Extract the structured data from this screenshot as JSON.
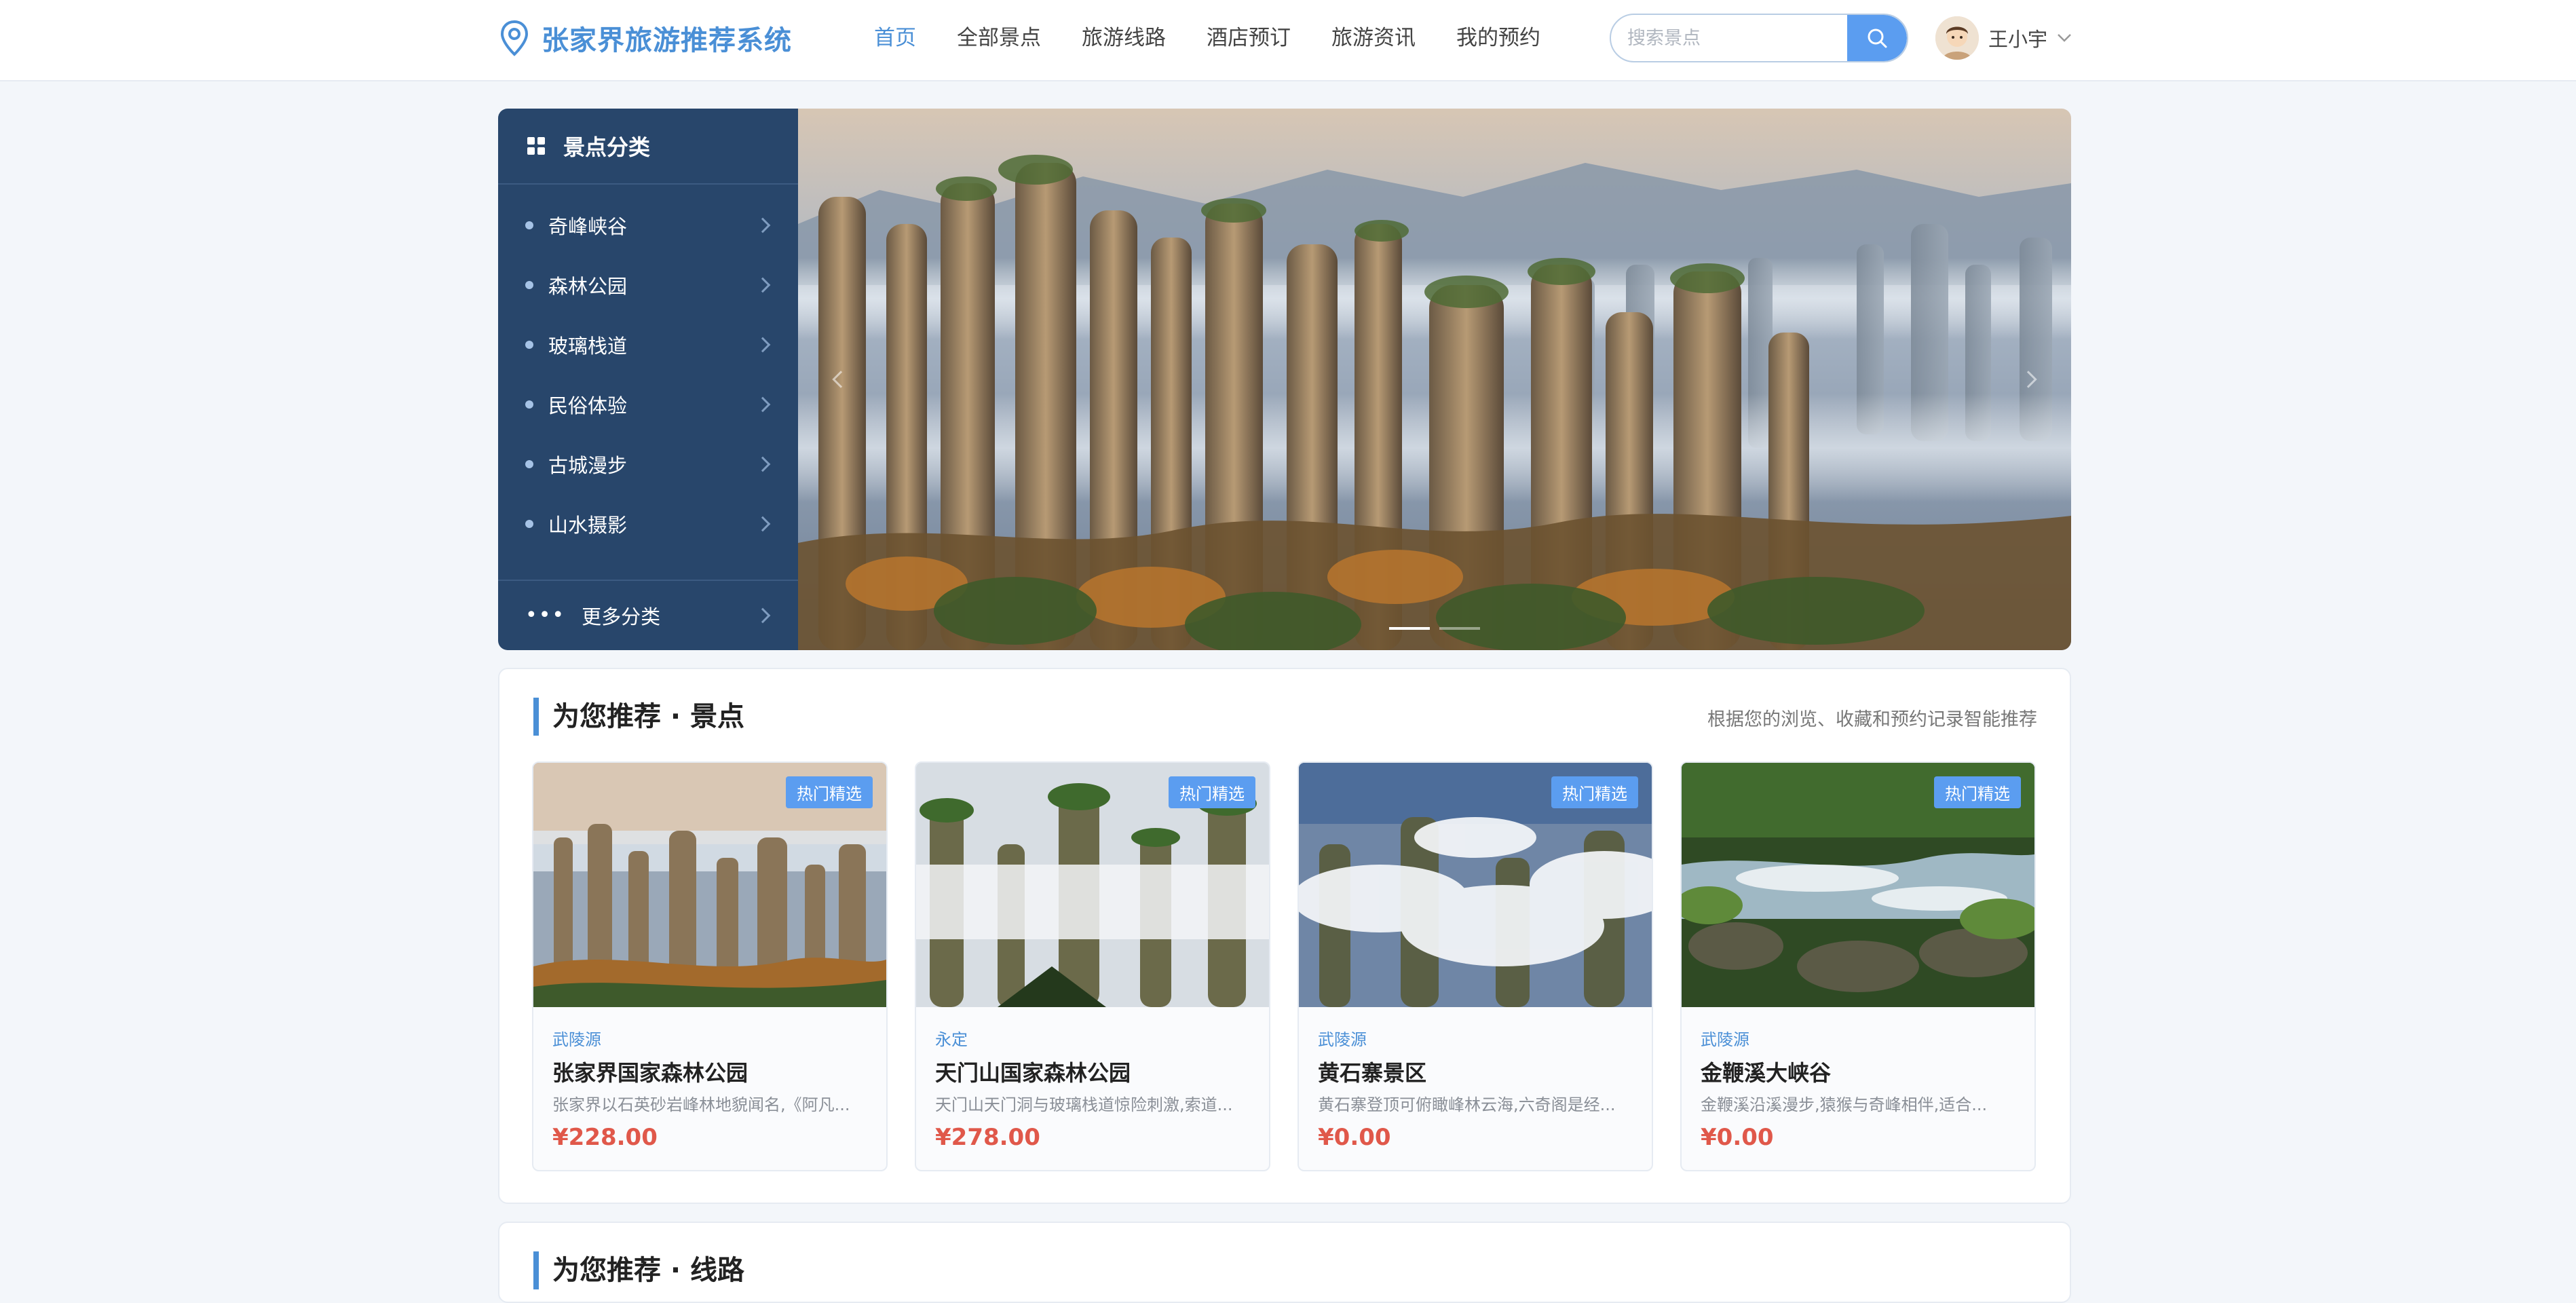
{
  "header": {
    "brand": "张家界旅游推荐系统",
    "nav": [
      "首页",
      "全部景点",
      "旅游线路",
      "酒店预订",
      "旅游资讯",
      "我的预约"
    ],
    "active_index": 0,
    "search_placeholder": "搜索景点",
    "user_name": "王小宇"
  },
  "categories": {
    "title": "景点分类",
    "items": [
      "奇峰峡谷",
      "森林公园",
      "玻璃栈道",
      "民俗体验",
      "古城漫步",
      "山水摄影"
    ],
    "more": "更多分类"
  },
  "banner": {
    "slides": 2,
    "active_slide": 0
  },
  "recommend": {
    "title": "为您推荐 · 景点",
    "subtitle": "根据您的浏览、收藏和预约记录智能推荐",
    "cards": [
      {
        "tag": "热门精选",
        "region": "武陵源",
        "name": "张家界国家森林公园",
        "desc": "张家界以石英砂岩峰林地貌闻名,《阿凡...",
        "price": "¥228.00"
      },
      {
        "tag": "热门精选",
        "region": "永定",
        "name": "天门山国家森林公园",
        "desc": "天门山天门洞与玻璃栈道惊险刺激,索道...",
        "price": "¥278.00"
      },
      {
        "tag": "热门精选",
        "region": "武陵源",
        "name": "黄石寨景区",
        "desc": "黄石寨登顶可俯瞰峰林云海,六奇阁是经...",
        "price": "¥0.00"
      },
      {
        "tag": "热门精选",
        "region": "武陵源",
        "name": "金鞭溪大峡谷",
        "desc": "金鞭溪沿溪漫步,猿猴与奇峰相伴,适合...",
        "price": "¥0.00"
      }
    ]
  },
  "recommend2": {
    "title": "为您推荐 · 线路"
  },
  "colors": {
    "accent": "#4a8fd6",
    "sidebar": "#28466b",
    "price": "#e0584a",
    "tag": "#5b9df0"
  }
}
